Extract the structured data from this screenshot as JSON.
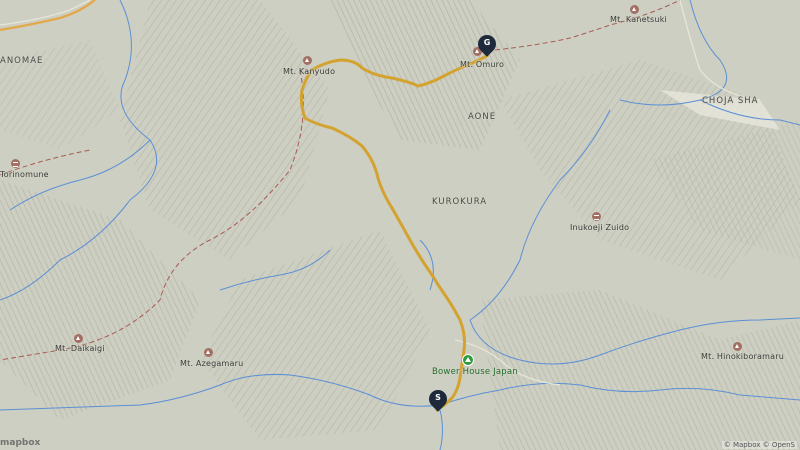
{
  "map": {
    "peaks": [
      "Mt. Kanyudo",
      "Mt. Omuro",
      "Mt. Kanetsuki",
      "Mt. Daikaigi",
      "Mt. Azegamaru",
      "Mt. Hinokiboramaru"
    ],
    "shrines": [
      "Torinomune",
      "Inukoeji Zuido"
    ],
    "areas": [
      "ANOMAE",
      "AONE",
      "KUROKURA",
      "CHOJA SHA"
    ],
    "poi": "Bower House Japan",
    "start_label": "S",
    "goal_label": "G",
    "attribution": "© Mapbox © OpenS",
    "logo": "mapbox",
    "colors": {
      "route": "#d4a22f",
      "terrain": "#c9cabb",
      "water": "#5c8fd6",
      "border": "#a85a52",
      "pin": "#1e2a3b",
      "camp": "#2f9a3d"
    }
  }
}
